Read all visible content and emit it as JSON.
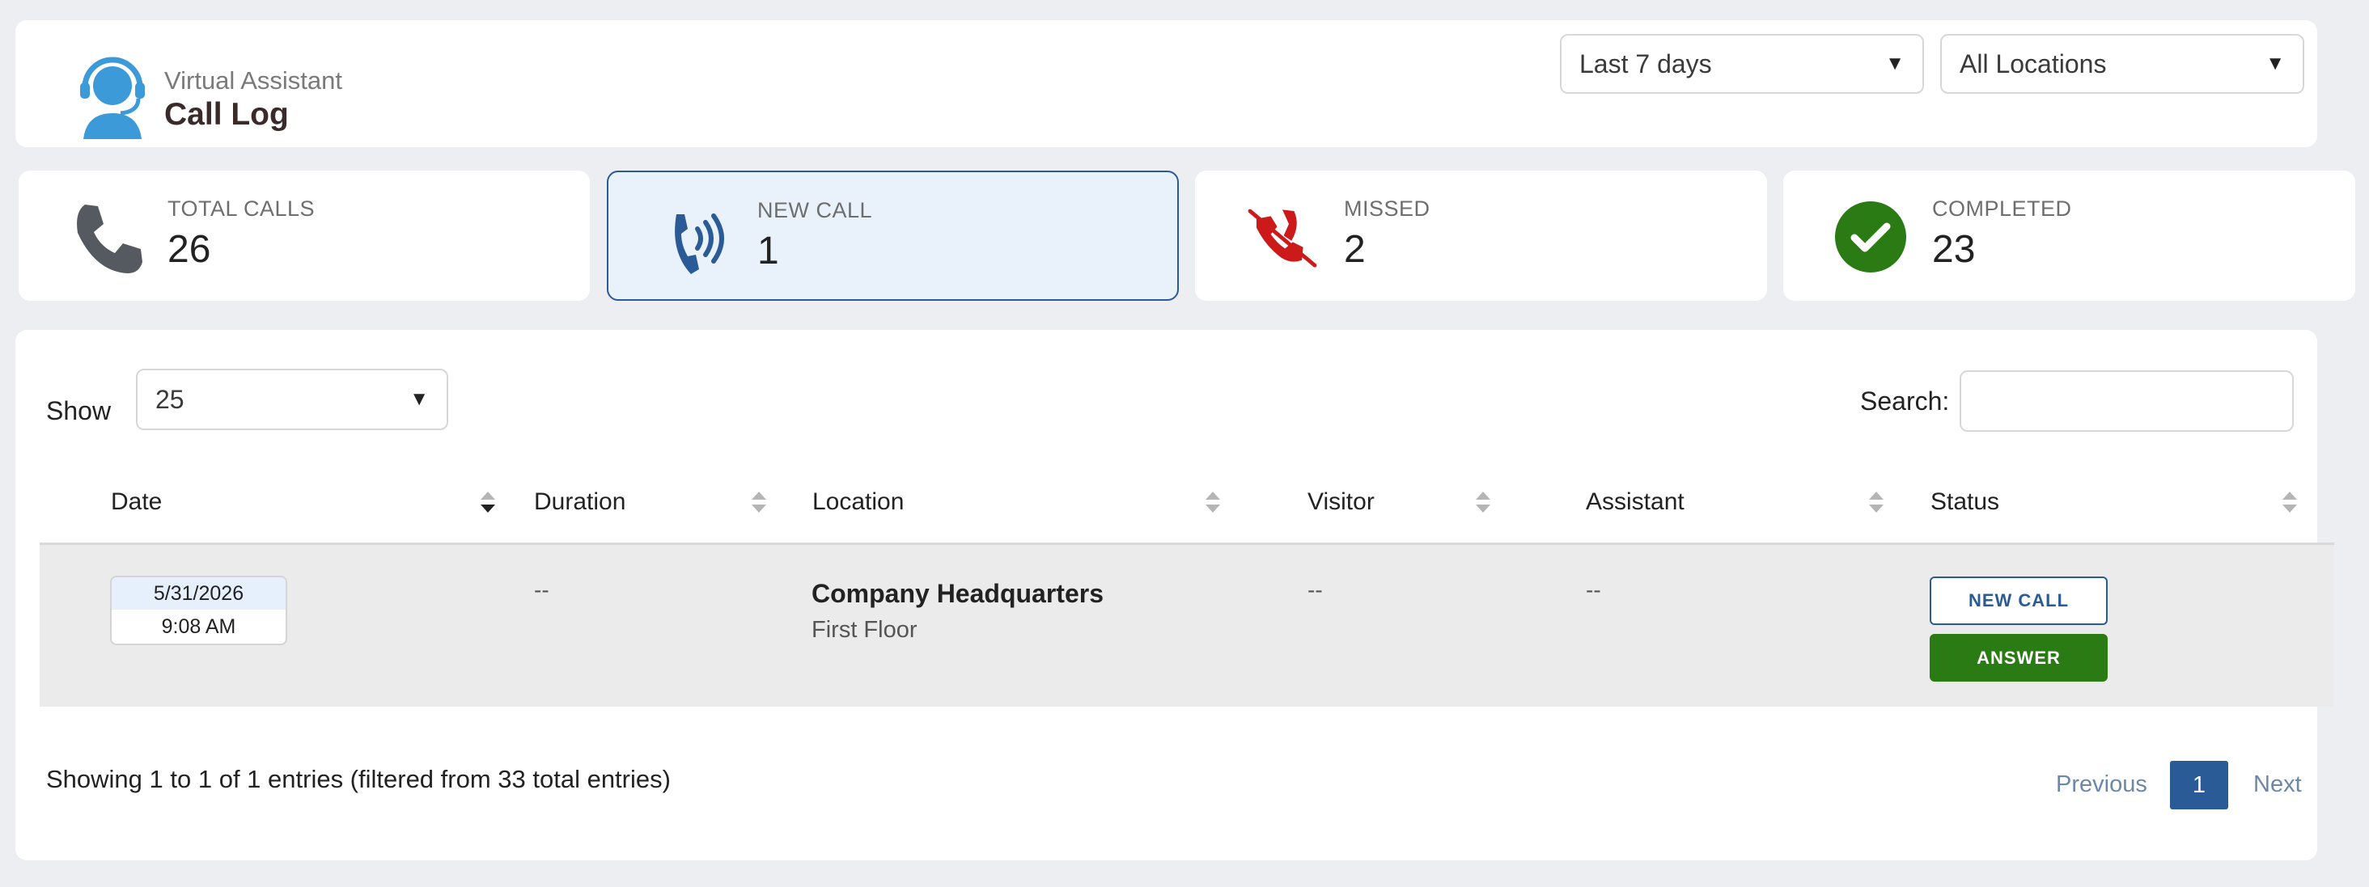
{
  "header": {
    "subtitle": "Virtual Assistant",
    "title": "Call Log",
    "icon": "headset-agent-icon",
    "range_select": "Last 7 days",
    "location_select": "All Locations"
  },
  "stats": {
    "total": {
      "label": "TOTAL CALLS",
      "value": "26",
      "icon": "phone-icon",
      "color": "#555a60"
    },
    "new": {
      "label": "NEW CALL",
      "value": "1",
      "icon": "ringing-phone-icon",
      "color": "#2a5b96"
    },
    "missed": {
      "label": "MISSED",
      "value": "2",
      "icon": "missed-call-icon",
      "color": "#cc1a1a"
    },
    "completed": {
      "label": "COMPLETED",
      "value": "23",
      "icon": "check-circle-icon",
      "color": "#2a7b13"
    }
  },
  "table": {
    "show_label": "Show",
    "page_size": "25",
    "search_label": "Search:",
    "search_value": "",
    "columns": [
      "Date",
      "Duration",
      "Location",
      "Visitor",
      "Assistant",
      "Status"
    ],
    "rows": [
      {
        "date": "5/31/2026",
        "time": "9:08 AM",
        "duration": "--",
        "location": "Company Headquarters",
        "floor": "First Floor",
        "visitor": "--",
        "assistant": "--",
        "status_button": "NEW CALL",
        "action_button": "ANSWER"
      }
    ],
    "info": "Showing 1 to 1 of 1 entries (filtered from 33 total entries)",
    "pagination": {
      "previous": "Previous",
      "current": "1",
      "next": "Next"
    }
  },
  "colors": {
    "accent": "#2a5b96",
    "success": "#2a7b13",
    "danger": "#cc1a1a",
    "brand_icon": "#3d9ad8"
  }
}
